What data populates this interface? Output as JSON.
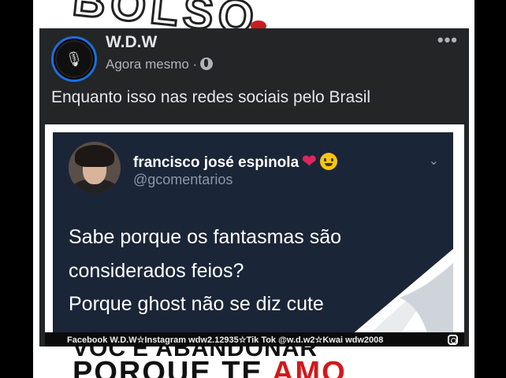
{
  "post": {
    "author": "W.D.W",
    "time": "Agora mesmo ·",
    "text": "Enquanto isso nas redes sociais pelo Brasil",
    "more": "•••",
    "avatar_glyph": "🎙"
  },
  "tweet": {
    "name": "francisco josé espinola",
    "heart": "❤",
    "handle": "@gcomentarios",
    "chevron": "⌄",
    "lines": [
      "Sabe porque os fantasmas são",
      "considerados feios?",
      "Porque ghost não se diz cute"
    ]
  },
  "watermark": "Facebook W.D.W☆Instagram wdw2.12935☆Tik Tok @w.d.w2☆Kwai wdw2008",
  "background": {
    "bottom_line1": "VOC'E ABANDONAR",
    "bottom_line2_a": "PORQUE TE ",
    "bottom_line2_b": "AMO"
  },
  "colors": {
    "facebook_dark": "#242526",
    "tweet_bg": "#1b2538",
    "accent_blue": "#1b6fe0",
    "heart_red": "#e0245e"
  }
}
